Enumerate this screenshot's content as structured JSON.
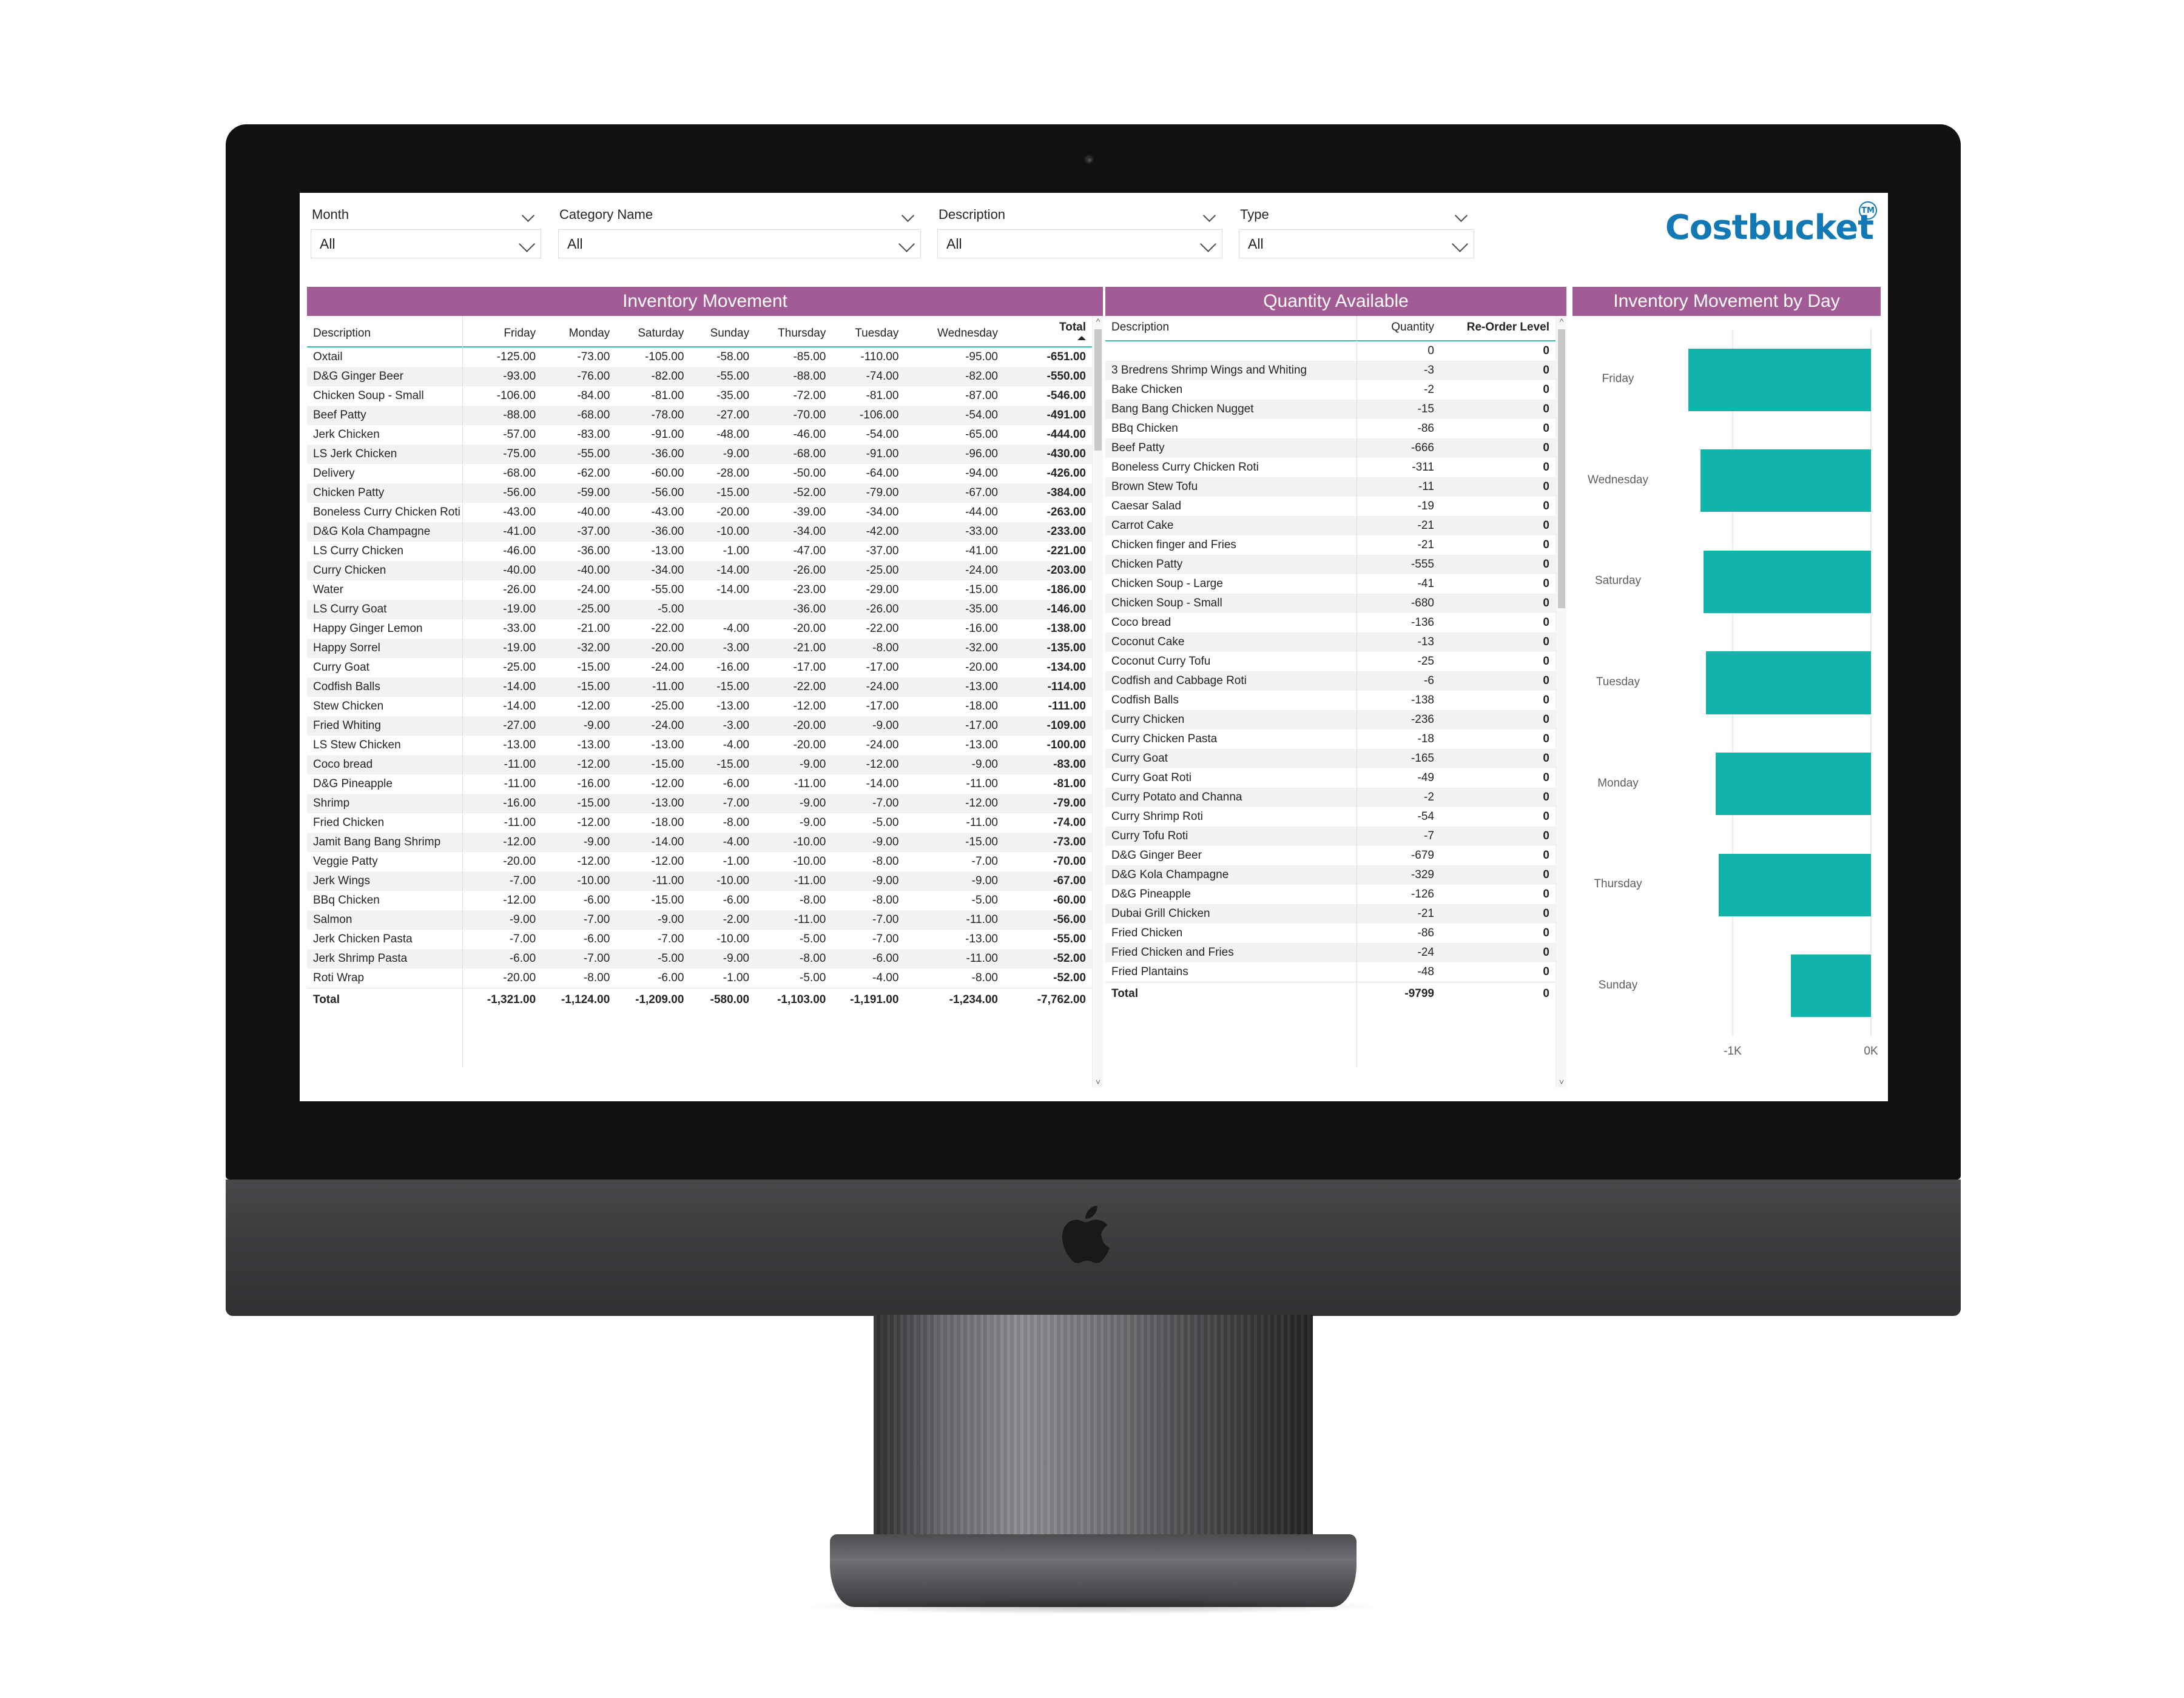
{
  "app": {
    "logo_text": "Costbucket",
    "logo_tm": "TM",
    "logo_color": "#1379b5",
    "accent_header": "#a35b95",
    "accent_bar": "#12b3a8"
  },
  "filters": [
    {
      "label": "Month",
      "value": "All",
      "icon": "chevron-down-icon"
    },
    {
      "label": "Category Name",
      "value": "All",
      "icon": "chevron-down-icon"
    },
    {
      "label": "Description",
      "value": "All",
      "icon": "chevron-down-icon"
    },
    {
      "label": "Type",
      "value": "All",
      "icon": "chevron-down-icon"
    }
  ],
  "inventory_movement": {
    "title": "Inventory Movement",
    "columns": [
      "Description",
      "Friday",
      "Monday",
      "Saturday",
      "Sunday",
      "Thursday",
      "Tuesday",
      "Wednesday",
      "Total"
    ],
    "sorted_column": "Total",
    "sort_direction": "asc",
    "rows": [
      [
        "Oxtail",
        "-125.00",
        "-73.00",
        "-105.00",
        "-58.00",
        "-85.00",
        "-110.00",
        "-95.00",
        "-651.00"
      ],
      [
        "D&G Ginger Beer",
        "-93.00",
        "-76.00",
        "-82.00",
        "-55.00",
        "-88.00",
        "-74.00",
        "-82.00",
        "-550.00"
      ],
      [
        "Chicken Soup - Small",
        "-106.00",
        "-84.00",
        "-81.00",
        "-35.00",
        "-72.00",
        "-81.00",
        "-87.00",
        "-546.00"
      ],
      [
        "Beef Patty",
        "-88.00",
        "-68.00",
        "-78.00",
        "-27.00",
        "-70.00",
        "-106.00",
        "-54.00",
        "-491.00"
      ],
      [
        "Jerk Chicken",
        "-57.00",
        "-83.00",
        "-91.00",
        "-48.00",
        "-46.00",
        "-54.00",
        "-65.00",
        "-444.00"
      ],
      [
        "LS Jerk Chicken",
        "-75.00",
        "-55.00",
        "-36.00",
        "-9.00",
        "-68.00",
        "-91.00",
        "-96.00",
        "-430.00"
      ],
      [
        "Delivery",
        "-68.00",
        "-62.00",
        "-60.00",
        "-28.00",
        "-50.00",
        "-64.00",
        "-94.00",
        "-426.00"
      ],
      [
        "Chicken Patty",
        "-56.00",
        "-59.00",
        "-56.00",
        "-15.00",
        "-52.00",
        "-79.00",
        "-67.00",
        "-384.00"
      ],
      [
        "Boneless Curry Chicken Roti",
        "-43.00",
        "-40.00",
        "-43.00",
        "-20.00",
        "-39.00",
        "-34.00",
        "-44.00",
        "-263.00"
      ],
      [
        "D&G Kola Champagne",
        "-41.00",
        "-37.00",
        "-36.00",
        "-10.00",
        "-34.00",
        "-42.00",
        "-33.00",
        "-233.00"
      ],
      [
        "LS Curry Chicken",
        "-46.00",
        "-36.00",
        "-13.00",
        "-1.00",
        "-47.00",
        "-37.00",
        "-41.00",
        "-221.00"
      ],
      [
        "Curry Chicken",
        "-40.00",
        "-40.00",
        "-34.00",
        "-14.00",
        "-26.00",
        "-25.00",
        "-24.00",
        "-203.00"
      ],
      [
        "Water",
        "-26.00",
        "-24.00",
        "-55.00",
        "-14.00",
        "-23.00",
        "-29.00",
        "-15.00",
        "-186.00"
      ],
      [
        "LS Curry Goat",
        "-19.00",
        "-25.00",
        "-5.00",
        "",
        "-36.00",
        "-26.00",
        "-35.00",
        "-146.00"
      ],
      [
        "Happy Ginger Lemon",
        "-33.00",
        "-21.00",
        "-22.00",
        "-4.00",
        "-20.00",
        "-22.00",
        "-16.00",
        "-138.00"
      ],
      [
        "Happy Sorrel",
        "-19.00",
        "-32.00",
        "-20.00",
        "-3.00",
        "-21.00",
        "-8.00",
        "-32.00",
        "-135.00"
      ],
      [
        "Curry Goat",
        "-25.00",
        "-15.00",
        "-24.00",
        "-16.00",
        "-17.00",
        "-17.00",
        "-20.00",
        "-134.00"
      ],
      [
        "Codfish Balls",
        "-14.00",
        "-15.00",
        "-11.00",
        "-15.00",
        "-22.00",
        "-24.00",
        "-13.00",
        "-114.00"
      ],
      [
        "Stew Chicken",
        "-14.00",
        "-12.00",
        "-25.00",
        "-13.00",
        "-12.00",
        "-17.00",
        "-18.00",
        "-111.00"
      ],
      [
        "Fried Whiting",
        "-27.00",
        "-9.00",
        "-24.00",
        "-3.00",
        "-20.00",
        "-9.00",
        "-17.00",
        "-109.00"
      ],
      [
        "LS Stew Chicken",
        "-13.00",
        "-13.00",
        "-13.00",
        "-4.00",
        "-20.00",
        "-24.00",
        "-13.00",
        "-100.00"
      ],
      [
        "Coco bread",
        "-11.00",
        "-12.00",
        "-15.00",
        "-15.00",
        "-9.00",
        "-12.00",
        "-9.00",
        "-83.00"
      ],
      [
        "D&G Pineapple",
        "-11.00",
        "-16.00",
        "-12.00",
        "-6.00",
        "-11.00",
        "-14.00",
        "-11.00",
        "-81.00"
      ],
      [
        "Shrimp",
        "-16.00",
        "-15.00",
        "-13.00",
        "-7.00",
        "-9.00",
        "-7.00",
        "-12.00",
        "-79.00"
      ],
      [
        "Fried Chicken",
        "-11.00",
        "-12.00",
        "-18.00",
        "-8.00",
        "-9.00",
        "-5.00",
        "-11.00",
        "-74.00"
      ],
      [
        "Jamit Bang Bang Shrimp",
        "-12.00",
        "-9.00",
        "-14.00",
        "-4.00",
        "-10.00",
        "-9.00",
        "-15.00",
        "-73.00"
      ],
      [
        "Veggie Patty",
        "-20.00",
        "-12.00",
        "-12.00",
        "-1.00",
        "-10.00",
        "-8.00",
        "-7.00",
        "-70.00"
      ],
      [
        "Jerk Wings",
        "-7.00",
        "-10.00",
        "-11.00",
        "-10.00",
        "-11.00",
        "-9.00",
        "-9.00",
        "-67.00"
      ],
      [
        "BBq Chicken",
        "-12.00",
        "-6.00",
        "-15.00",
        "-6.00",
        "-8.00",
        "-8.00",
        "-5.00",
        "-60.00"
      ],
      [
        "Salmon",
        "-9.00",
        "-7.00",
        "-9.00",
        "-2.00",
        "-11.00",
        "-7.00",
        "-11.00",
        "-56.00"
      ],
      [
        "Jerk Chicken Pasta",
        "-7.00",
        "-6.00",
        "-7.00",
        "-10.00",
        "-5.00",
        "-7.00",
        "-13.00",
        "-55.00"
      ],
      [
        "Jerk Shrimp Pasta",
        "-6.00",
        "-7.00",
        "-5.00",
        "-9.00",
        "-8.00",
        "-6.00",
        "-11.00",
        "-52.00"
      ],
      [
        "Roti Wrap",
        "-20.00",
        "-8.00",
        "-6.00",
        "-1.00",
        "-5.00",
        "-4.00",
        "-8.00",
        "-52.00"
      ]
    ],
    "total_row": [
      "Total",
      "-1,321.00",
      "-1,124.00",
      "-1,209.00",
      "-580.00",
      "-1,103.00",
      "-1,191.00",
      "-1,234.00",
      "-7,762.00"
    ]
  },
  "quantity_available": {
    "title": "Quantity Available",
    "columns": [
      "Description",
      "Quantity",
      "Re-Order Level"
    ],
    "rows": [
      [
        "",
        "0",
        "0"
      ],
      [
        "3 Bredrens Shrimp Wings and Whiting",
        "-3",
        "0"
      ],
      [
        "Bake Chicken",
        "-2",
        "0"
      ],
      [
        "Bang Bang Chicken Nugget",
        "-15",
        "0"
      ],
      [
        "BBq Chicken",
        "-86",
        "0"
      ],
      [
        "Beef Patty",
        "-666",
        "0"
      ],
      [
        "Boneless Curry Chicken Roti",
        "-311",
        "0"
      ],
      [
        "Brown Stew Tofu",
        "-11",
        "0"
      ],
      [
        "Caesar Salad",
        "-19",
        "0"
      ],
      [
        "Carrot Cake",
        "-21",
        "0"
      ],
      [
        "Chicken finger and Fries",
        "-21",
        "0"
      ],
      [
        "Chicken Patty",
        "-555",
        "0"
      ],
      [
        "Chicken Soup - Large",
        "-41",
        "0"
      ],
      [
        "Chicken Soup - Small",
        "-680",
        "0"
      ],
      [
        "Coco bread",
        "-136",
        "0"
      ],
      [
        "Coconut Cake",
        "-13",
        "0"
      ],
      [
        "Coconut Curry Tofu",
        "-25",
        "0"
      ],
      [
        "Codfish and Cabbage Roti",
        "-6",
        "0"
      ],
      [
        "Codfish Balls",
        "-138",
        "0"
      ],
      [
        "Curry Chicken",
        "-236",
        "0"
      ],
      [
        "Curry Chicken Pasta",
        "-18",
        "0"
      ],
      [
        "Curry Goat",
        "-165",
        "0"
      ],
      [
        "Curry Goat Roti",
        "-49",
        "0"
      ],
      [
        "Curry Potato and Channa",
        "-2",
        "0"
      ],
      [
        "Curry Shrimp Roti",
        "-54",
        "0"
      ],
      [
        "Curry Tofu Roti",
        "-7",
        "0"
      ],
      [
        "D&G Ginger Beer",
        "-679",
        "0"
      ],
      [
        "D&G Kola Champagne",
        "-329",
        "0"
      ],
      [
        "D&G Pineapple",
        "-126",
        "0"
      ],
      [
        "Dubai Grill Chicken",
        "-21",
        "0"
      ],
      [
        "Fried Chicken",
        "-86",
        "0"
      ],
      [
        "Fried Chicken and Fries",
        "-24",
        "0"
      ],
      [
        "Fried Plantains",
        "-48",
        "0"
      ]
    ],
    "total_row": [
      "Total",
      "-9799",
      "0"
    ]
  },
  "chart_data": {
    "type": "bar",
    "orientation": "horizontal",
    "title": "Inventory Movement by Day",
    "categories": [
      "Friday",
      "Wednesday",
      "Saturday",
      "Tuesday",
      "Monday",
      "Thursday",
      "Sunday"
    ],
    "values": [
      -1321,
      -1234,
      -1209,
      -1191,
      -1124,
      -1103,
      -580
    ],
    "xlabel": "",
    "ylabel": "",
    "xlim": [
      -1500,
      0
    ],
    "xticks": [
      -1000,
      0
    ],
    "xtick_labels": [
      "-1K",
      "0K"
    ],
    "grid": true,
    "legend": "none",
    "bar_color": "#12b3a8"
  }
}
